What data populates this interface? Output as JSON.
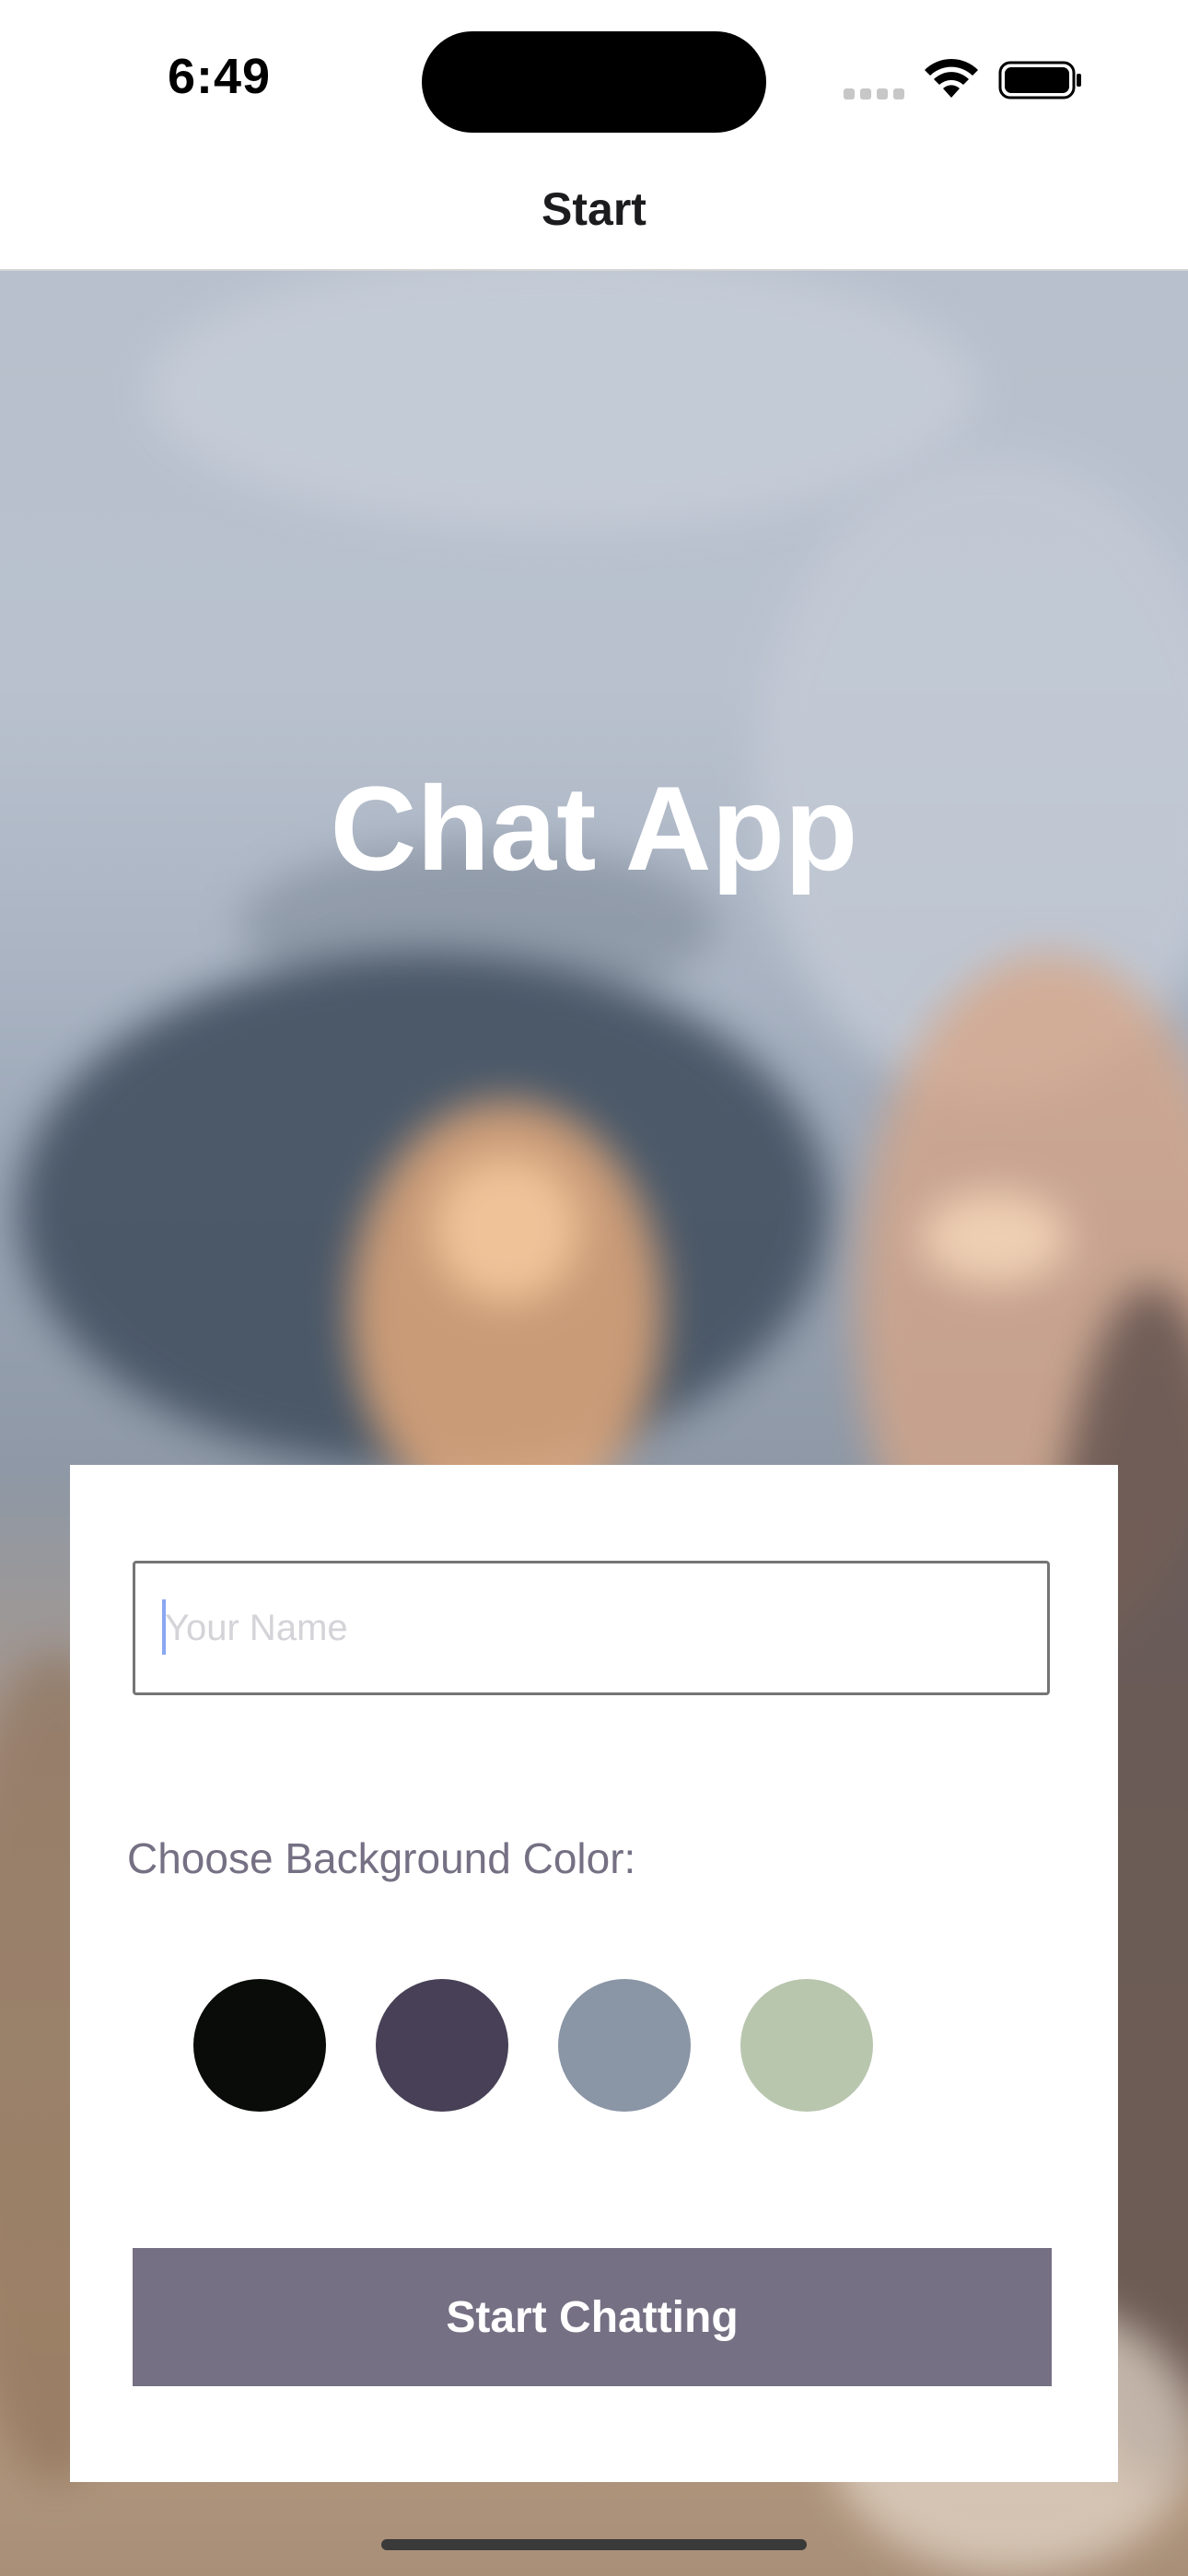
{
  "status_bar": {
    "time": "6:49"
  },
  "nav": {
    "title": "Start"
  },
  "app": {
    "title": "Chat App"
  },
  "form": {
    "name_placeholder": "Your Name",
    "name_value": "",
    "color_label": "Choose Background Color:",
    "colors": [
      "#090C08",
      "#474056",
      "#8A95A5",
      "#B9C6AE"
    ],
    "start_label": "Start Chatting"
  }
}
